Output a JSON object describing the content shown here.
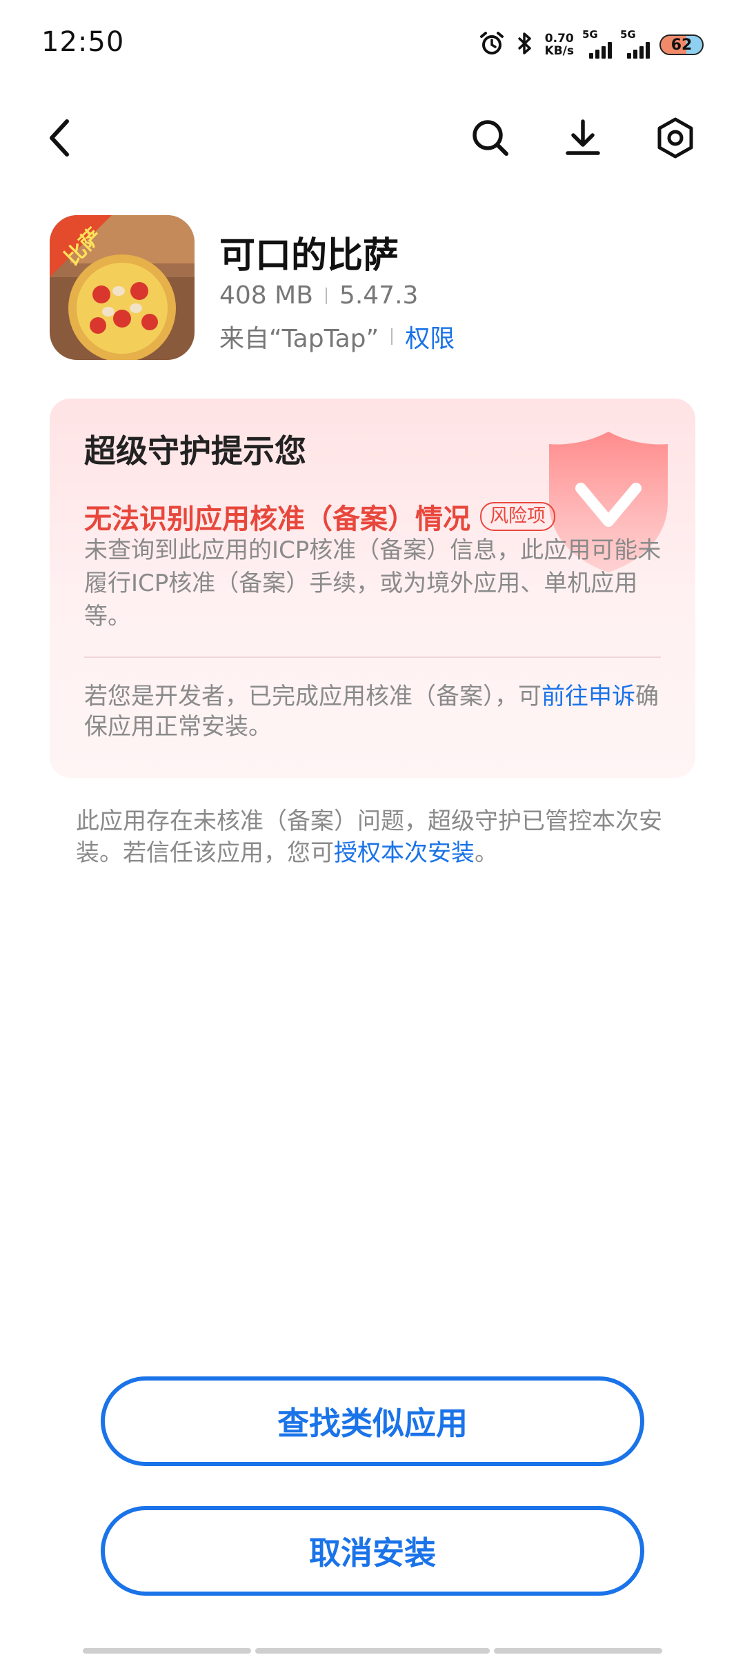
{
  "status_bar": {
    "time": "12:50",
    "net_speed_value": "0.70",
    "net_speed_unit": "KB/s",
    "sim1_label": "5G",
    "sim2_label": "5G",
    "battery_level": "62"
  },
  "nav": {
    "icons": [
      "back-icon",
      "search-icon",
      "download-icon",
      "settings-icon"
    ]
  },
  "app": {
    "name": "可口的比萨",
    "size": "408 MB",
    "version": "5.47.3",
    "source": "来自“TapTap”",
    "permissions_link": "权限",
    "icon_badge_text": "比萨"
  },
  "warning_card": {
    "title": "超级守护提示您",
    "subtitle": "无法识别应用核准（备案）情况",
    "risk_badge": "风险项",
    "description": "未查询到此应用的ICP核准（备案）信息，此应用可能未履行ICP核准（备案）手续，或为境外应用、单机应用等。",
    "developer_text": "若您是开发者，已完成应用核准（备案），可",
    "developer_link": "前往申诉",
    "developer_text_after": "确保应用正常安装。"
  },
  "notice": {
    "text": "此应用存在未核准（备案）问题，超级守护已管控本次安装。若信任该应用，您可",
    "link": "授权本次安装",
    "text_after": "。"
  },
  "buttons": {
    "find_similar": "查找类似应用",
    "cancel_install": "取消安装"
  },
  "colors": {
    "accent": "#1a73e8",
    "warning_red": "#e8473c"
  }
}
